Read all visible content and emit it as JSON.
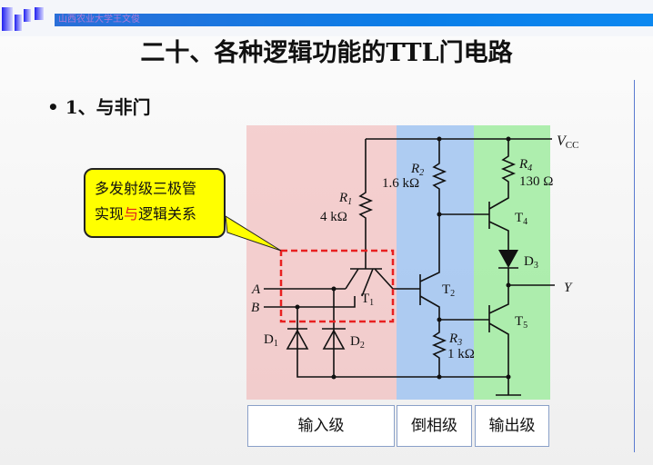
{
  "header": {
    "banner_text": "山西农业大学王文俊"
  },
  "title": "二十、各种逻辑功能的TTL门电路",
  "bullet": "• 1、与非门",
  "callout": {
    "line1": "多发射级三极管",
    "line2_a": "实现",
    "line2_highlight": "与",
    "line2_b": "逻辑关系",
    "highlight_color": "#e02020"
  },
  "circuit": {
    "vcc": "V",
    "vcc_sub": "CC",
    "r1": "R",
    "r1_sub": "1",
    "r1_val": "4 kΩ",
    "r2": "R",
    "r2_sub": "2",
    "r2_val": "1.6 kΩ",
    "r3": "R",
    "r3_sub": "3",
    "r3_val": "1 kΩ",
    "r4": "R",
    "r4_sub": "4",
    "r4_val": "130 Ω",
    "t1": "T",
    "t1_sub": "1",
    "t2": "T",
    "t2_sub": "2",
    "t4": "T",
    "t4_sub": "4",
    "t5": "T",
    "t5_sub": "5",
    "d1": "D",
    "d1_sub": "1",
    "d2": "D",
    "d2_sub": "2",
    "d3": "D",
    "d3_sub": "3",
    "in_a": "A",
    "in_b": "B",
    "out_y": "Y"
  },
  "stages": {
    "input": "输入级",
    "inverter": "倒相级",
    "output": "输出级",
    "colors": {
      "input": "#f2c4c4",
      "inverter": "#a9c8f0",
      "output": "#a8eaa8"
    }
  }
}
